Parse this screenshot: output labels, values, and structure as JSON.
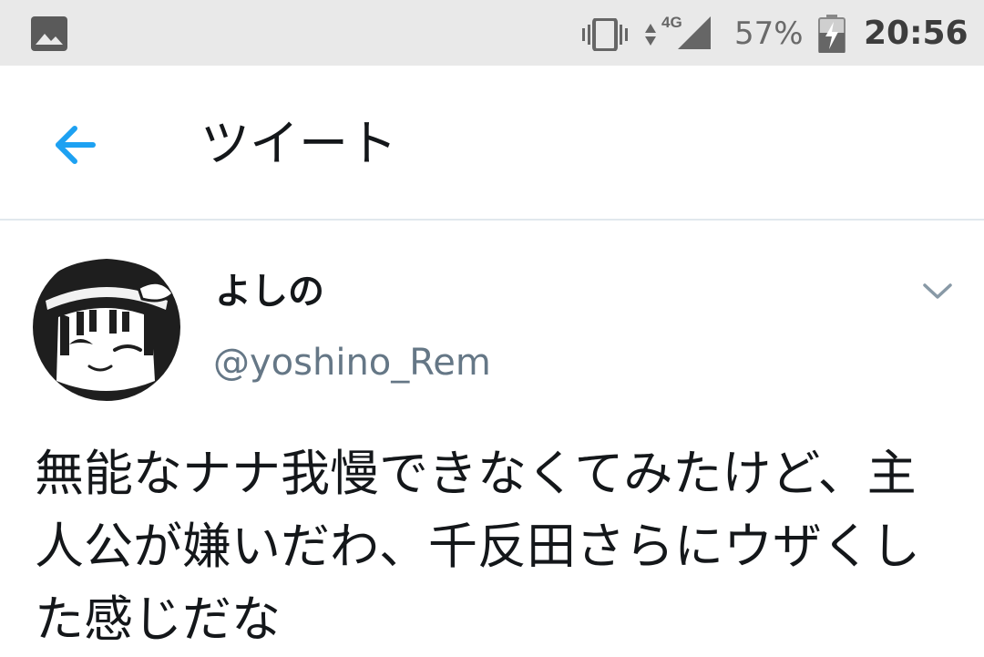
{
  "status_bar": {
    "notification_icon": "image-icon",
    "vibrate_icon": "vibrate-icon",
    "network_type": "4G",
    "signal_icon": "signal-icon",
    "battery_percent": "57%",
    "battery_icon": "battery-charging-icon",
    "time": "20:56"
  },
  "app_bar": {
    "back_icon": "arrow-left-icon",
    "title": "ツイート"
  },
  "tweet": {
    "author_name": "よしの",
    "author_handle": "@yoshino_Rem",
    "menu_icon": "chevron-down-icon",
    "text": "無能なナナ我慢できなくてみたけど、主人公が嫌いだわ、千反田さらにウザくした感じだな"
  },
  "colors": {
    "status_bar_bg": "#e9e9e9",
    "accent": "#1da1f2",
    "handle_gray": "#657786",
    "text": "#14171a",
    "divider": "#e1e8ed"
  }
}
